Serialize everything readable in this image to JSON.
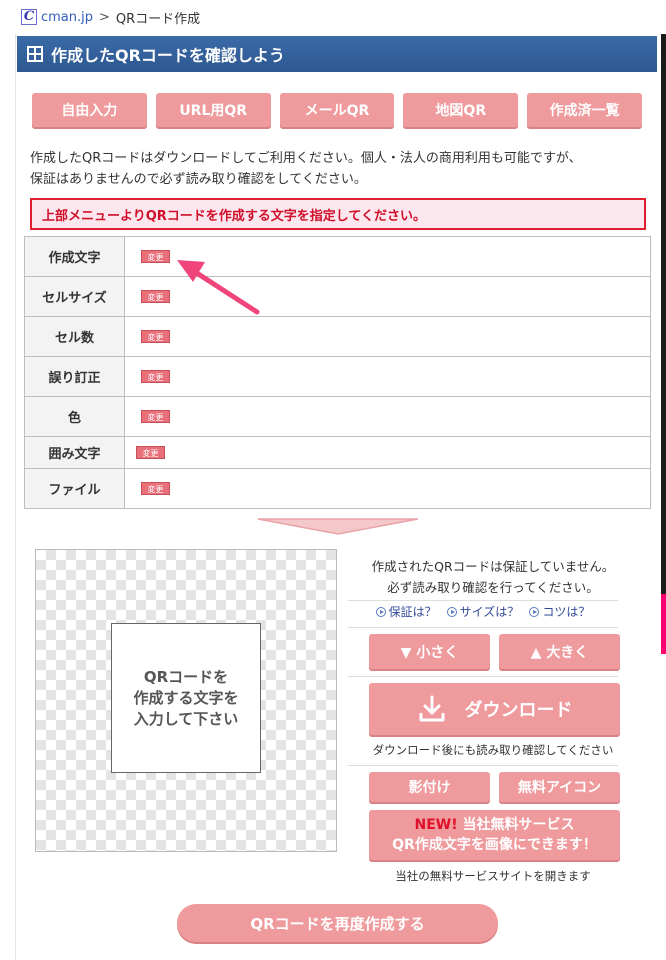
{
  "breadcrumb": {
    "logo": "C",
    "site": "cman.jp",
    "separator": ">",
    "page": "QRコード作成"
  },
  "header": {
    "title": "作成したQRコードを確認しよう"
  },
  "menu": [
    {
      "label": "自由入力"
    },
    {
      "label": "URL用QR"
    },
    {
      "label": "メールQR"
    },
    {
      "label": "地図QR"
    },
    {
      "label": "作成済一覧"
    }
  ],
  "intro": {
    "line1": "作成したQRコードはダウンロードしてご利用ください。個人・法人の商用利用も可能ですが、",
    "line2": "保証はありませんので必ず読み取り確認をしてください。"
  },
  "alert": "上部メニューよりQRコードを作成する文字を指定してください。",
  "settings": {
    "change_label": "変更",
    "rows": [
      {
        "label": "作成文字"
      },
      {
        "label": "セルサイズ"
      },
      {
        "label": "セル数"
      },
      {
        "label": "誤り訂正"
      },
      {
        "label": "色"
      },
      {
        "label": "囲み文字"
      },
      {
        "label": "ファイル"
      }
    ]
  },
  "preview": {
    "placeholder_line1": "QRコードを",
    "placeholder_line2": "作成する文字を",
    "placeholder_line3": "入力して下さい"
  },
  "right_panel": {
    "note_line1": "作成されたQRコードは保証していません。",
    "note_line2": "必ず読み取り確認を行ってください。",
    "help": [
      "保証は？",
      "サイズは？",
      "コツは？"
    ],
    "smaller": "▼ 小さく",
    "bigger": "▲ 大きく",
    "download": "ダウンロード",
    "download_note": "ダウンロード後にも読み取り確認してください",
    "shadow": "影付け",
    "free_icon": "無料アイコン",
    "promo_new": "NEW!",
    "promo_line1": " 当社無料サービス",
    "promo_line2": "QR作成文字を画像にできます！",
    "promo_note": "当社の無料サービスサイトを開きます"
  },
  "recreate": "QRコードを再度作成する",
  "colors": {
    "accent": "#ef9a9d",
    "header": "#2d5890",
    "alert": "#e0202d",
    "arrow": "#f0457a"
  }
}
